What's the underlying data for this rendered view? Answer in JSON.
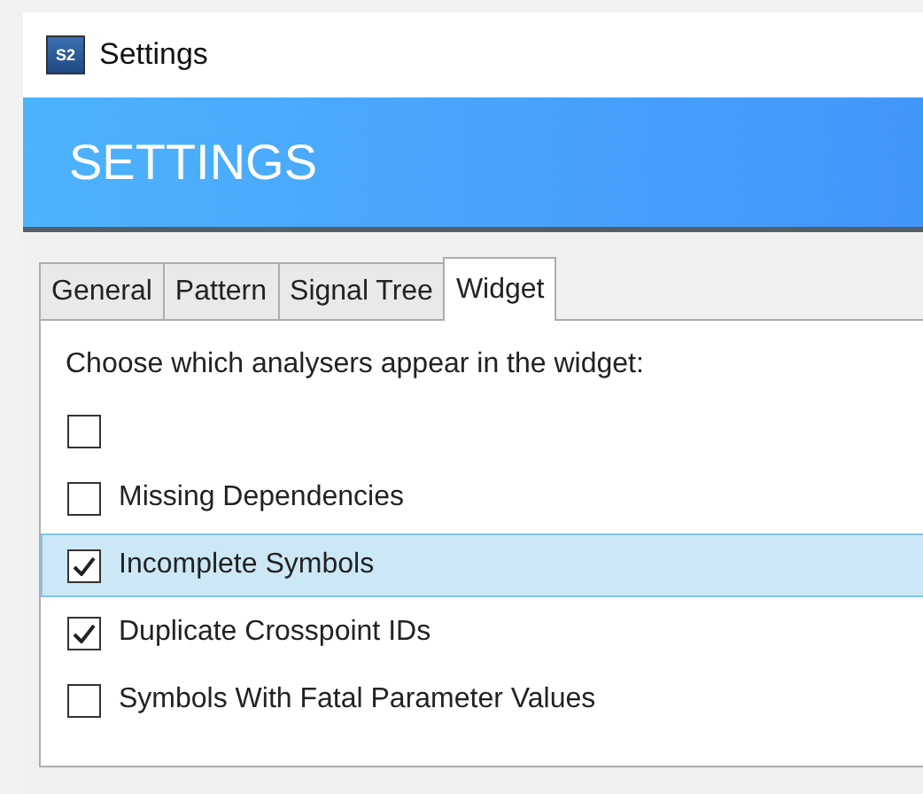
{
  "window": {
    "icon_text": "S2",
    "title": "Settings"
  },
  "banner": {
    "title": "SETTINGS"
  },
  "tabs": [
    {
      "label": "General",
      "selected": false
    },
    {
      "label": "Pattern",
      "selected": false
    },
    {
      "label": "Signal Tree",
      "selected": false
    },
    {
      "label": "Widget",
      "selected": true
    }
  ],
  "panel": {
    "prompt": "Choose which analysers appear in the widget:",
    "items": [
      {
        "checked": false,
        "selected": false
      },
      {
        "label": "Missing Dependencies",
        "checked": false,
        "selected": false
      },
      {
        "label": "Incomplete Symbols",
        "checked": true,
        "selected": true
      },
      {
        "label": "Duplicate Crosspoint IDs",
        "checked": true,
        "selected": false
      },
      {
        "label": "Symbols With Fatal Parameter Values",
        "checked": false,
        "selected": false
      }
    ]
  }
}
